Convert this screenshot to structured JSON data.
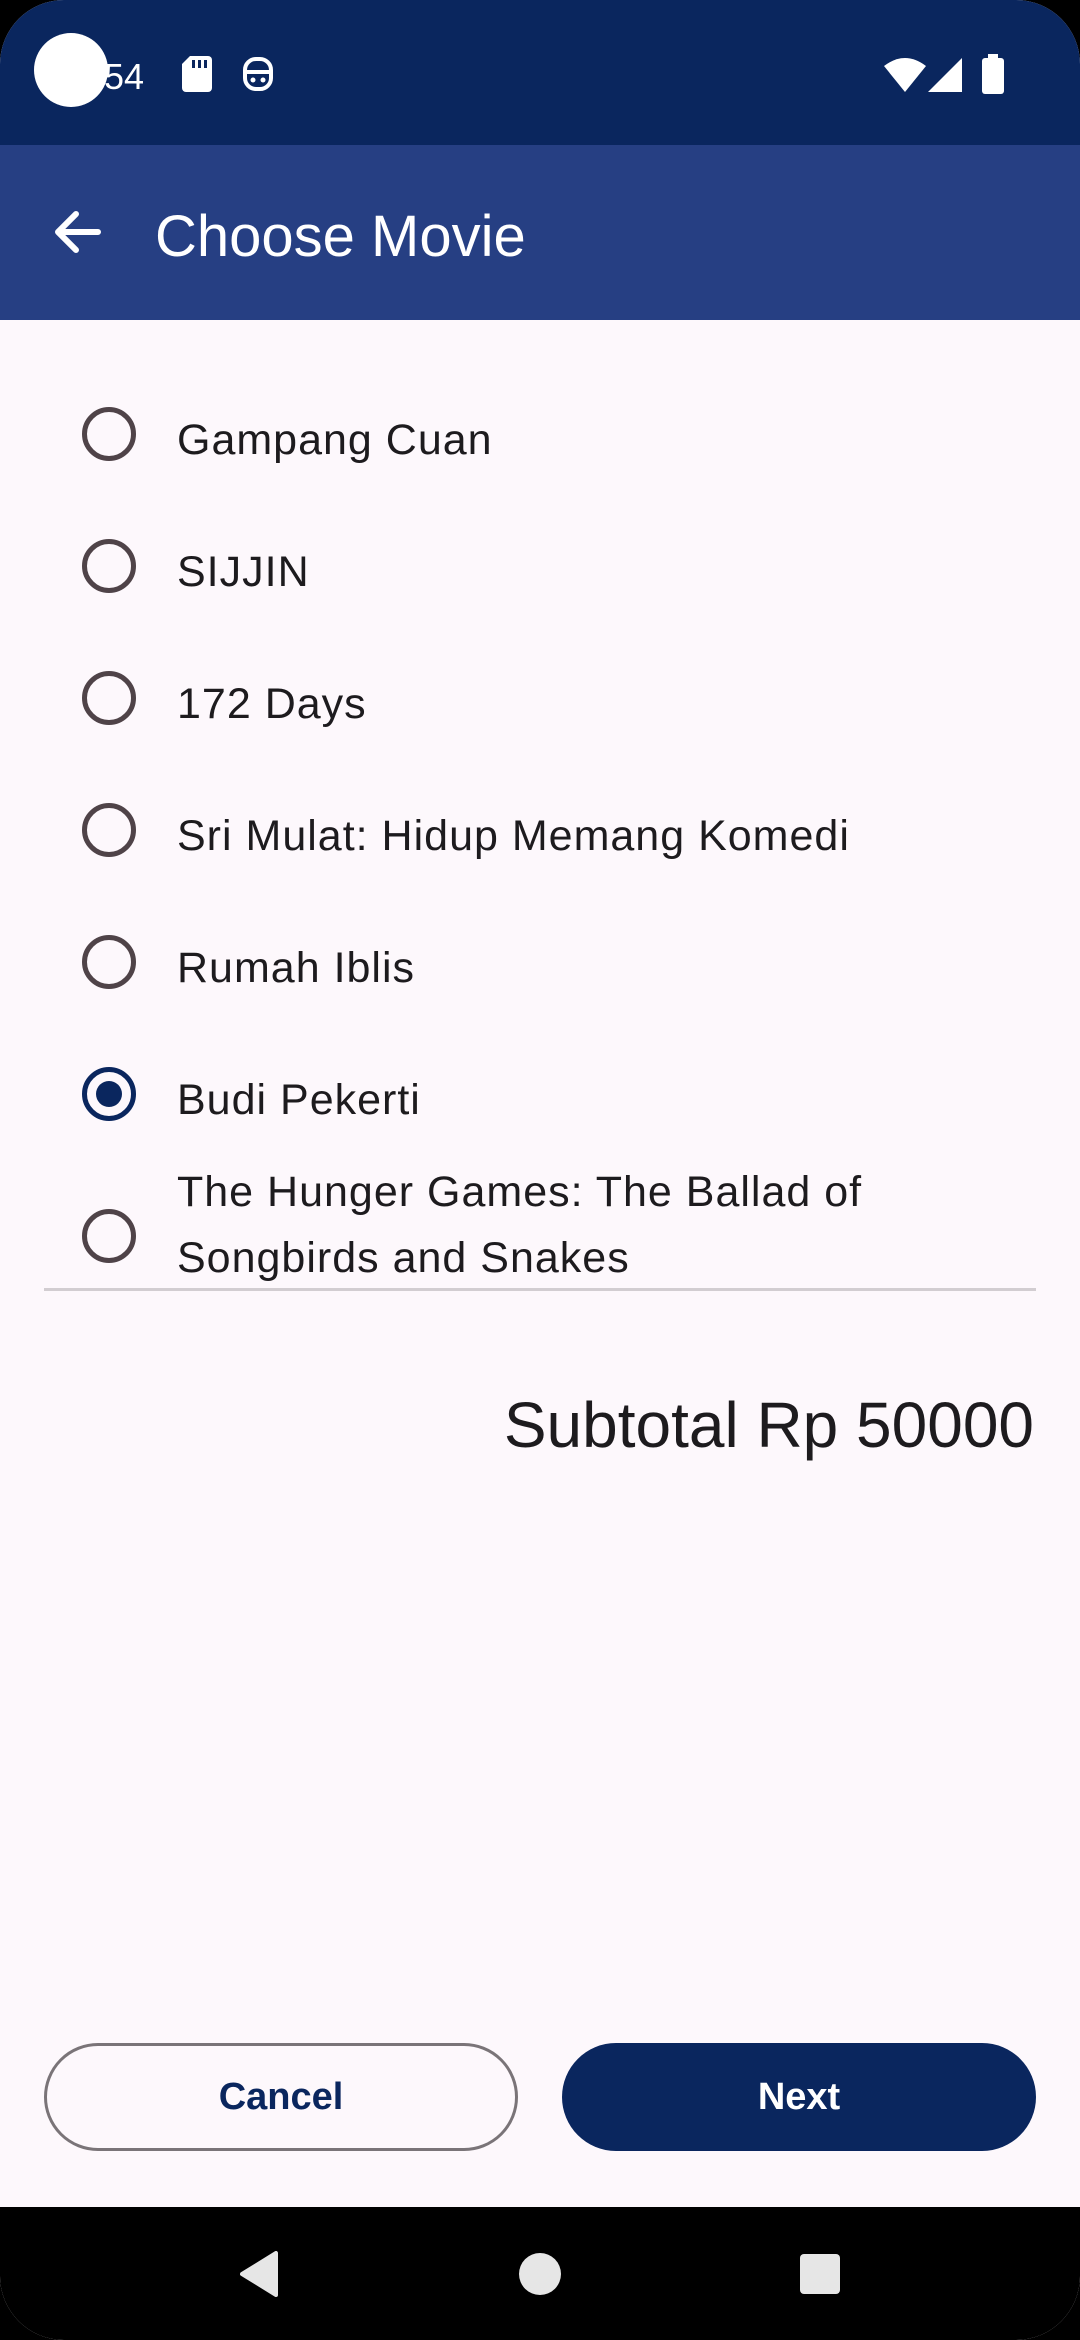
{
  "status_bar": {
    "time": "54",
    "icons": [
      "sd-card-icon",
      "face-icon",
      "wifi-icon",
      "signal-icon",
      "battery-icon"
    ]
  },
  "app_bar": {
    "title": "Choose Movie",
    "back_icon": "arrow-back-icon"
  },
  "movies": [
    {
      "label": "Gampang Cuan",
      "selected": false
    },
    {
      "label": "SIJJIN",
      "selected": false
    },
    {
      "label": "172 Days",
      "selected": false
    },
    {
      "label": "Sri Mulat: Hidup Memang Komedi",
      "selected": false
    },
    {
      "label": "Rumah Iblis",
      "selected": false
    },
    {
      "label": "Budi Pekerti",
      "selected": true
    },
    {
      "label": "The Hunger Games: The Ballad of Songbirds and Snakes",
      "selected": false
    }
  ],
  "subtotal": "Subtotal Rp 50000",
  "buttons": {
    "cancel": "Cancel",
    "next": "Next"
  },
  "nav": [
    "back-icon",
    "home-icon",
    "recents-icon"
  ],
  "colors": {
    "primary": "#0a265e",
    "app_bar": "#263f83",
    "background": "#fdf8fc"
  }
}
